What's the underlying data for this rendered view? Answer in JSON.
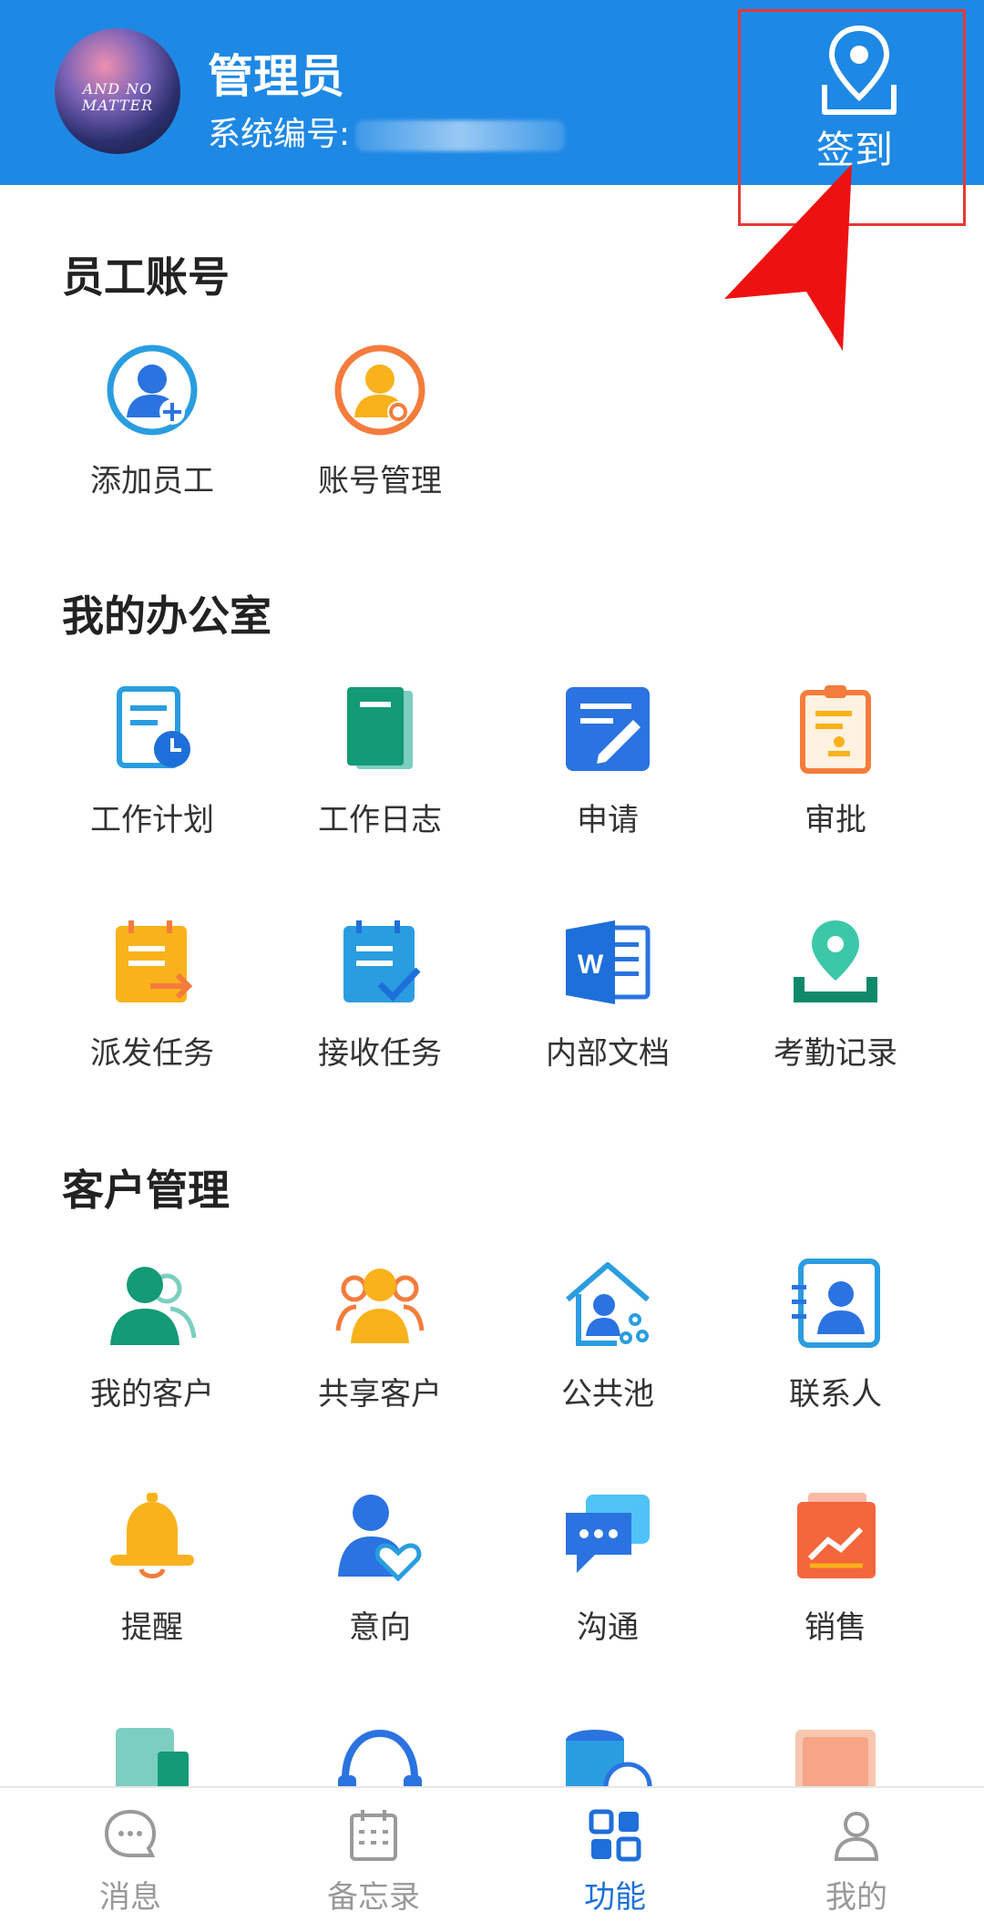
{
  "header": {
    "avatar_text_line1": "AND NO",
    "avatar_text_line2": "MATTER",
    "name": "管理员",
    "system_id_label": "系统编号:",
    "checkin_label": "签到"
  },
  "sections": {
    "employee": {
      "title": "员工账号",
      "items": [
        {
          "label": "添加员工",
          "icon": "add-user-icon"
        },
        {
          "label": "账号管理",
          "icon": "account-settings-icon"
        }
      ]
    },
    "office": {
      "title": "我的办公室",
      "items": [
        {
          "label": "工作计划",
          "icon": "work-plan-icon"
        },
        {
          "label": "工作日志",
          "icon": "work-log-icon"
        },
        {
          "label": "申请",
          "icon": "apply-icon"
        },
        {
          "label": "审批",
          "icon": "approval-icon"
        },
        {
          "label": "派发任务",
          "icon": "dispatch-task-icon"
        },
        {
          "label": "接收任务",
          "icon": "receive-task-icon"
        },
        {
          "label": "内部文档",
          "icon": "word-doc-icon"
        },
        {
          "label": "考勤记录",
          "icon": "attendance-icon"
        }
      ]
    },
    "customer": {
      "title": "客户管理",
      "items": [
        {
          "label": "我的客户",
          "icon": "my-customer-icon"
        },
        {
          "label": "共享客户",
          "icon": "shared-customer-icon"
        },
        {
          "label": "公共池",
          "icon": "public-pool-icon"
        },
        {
          "label": "联系人",
          "icon": "contact-icon"
        },
        {
          "label": "提醒",
          "icon": "bell-icon"
        },
        {
          "label": "意向",
          "icon": "intention-icon"
        },
        {
          "label": "沟通",
          "icon": "chat-icon"
        },
        {
          "label": "销售",
          "icon": "sales-chart-icon"
        }
      ]
    }
  },
  "bottom_nav": {
    "items": [
      {
        "label": "消息",
        "icon": "message-icon"
      },
      {
        "label": "备忘录",
        "icon": "calendar-icon"
      },
      {
        "label": "功能",
        "icon": "grid-icon"
      },
      {
        "label": "我的",
        "icon": "user-icon"
      }
    ],
    "active_index": 2
  },
  "colors": {
    "header_bg": "#1E88E5",
    "accent": "#1E6FD9",
    "highlight_box": "#e53935"
  }
}
